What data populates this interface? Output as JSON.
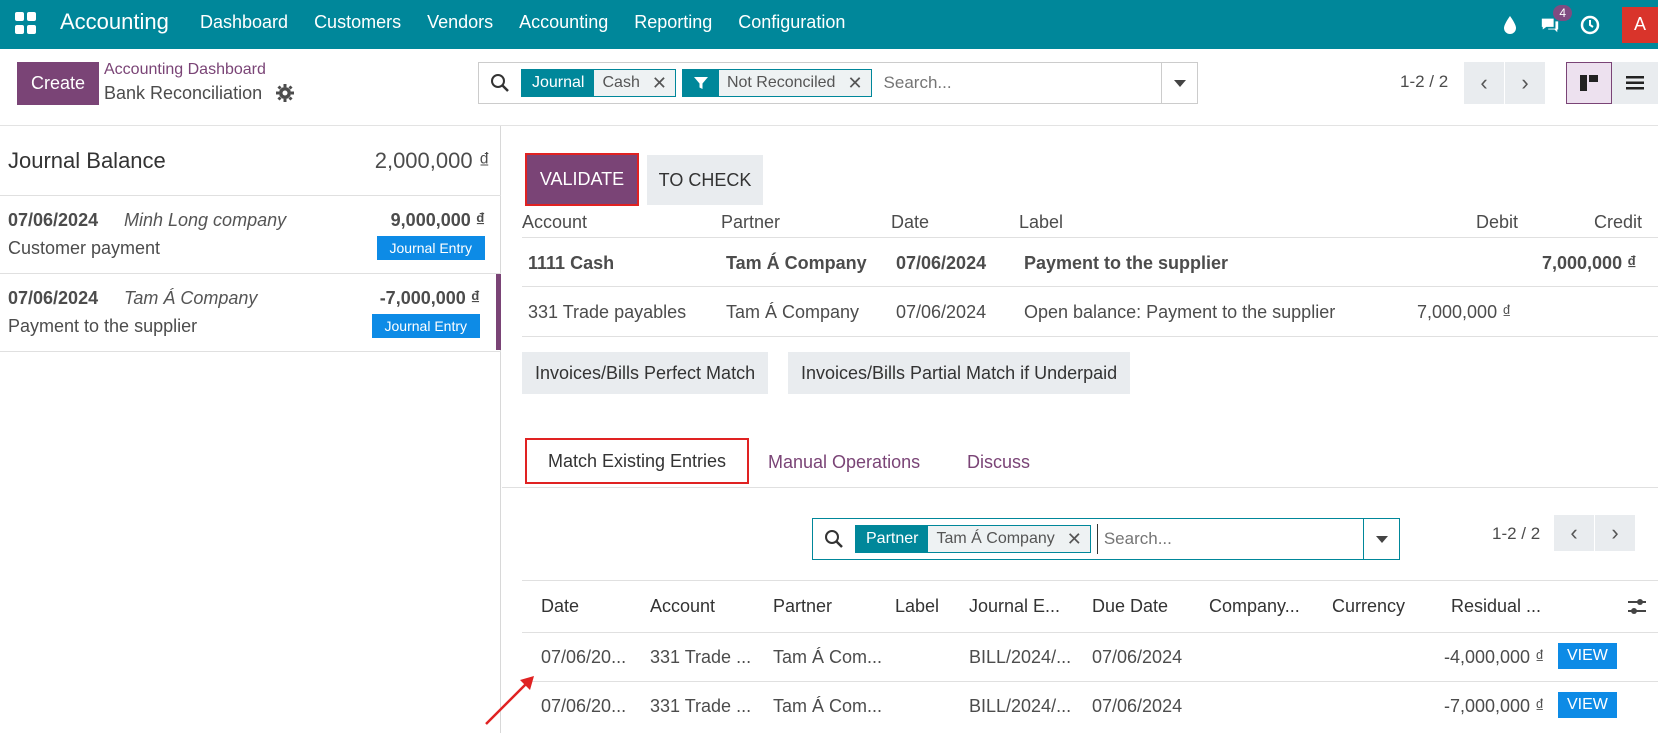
{
  "navbar": {
    "brand": "Accounting",
    "menu": [
      "Dashboard",
      "Customers",
      "Vendors",
      "Accounting",
      "Reporting",
      "Configuration"
    ],
    "chat_count": "4",
    "avatar_letter": "A",
    "bg_color": "#00879a"
  },
  "control": {
    "create_label": "Create",
    "breadcrumb_parent": "Accounting Dashboard",
    "breadcrumb_current": "Bank Reconciliation",
    "facets": [
      {
        "key": "Journal",
        "value": "Cash"
      },
      {
        "key": "filter-icon",
        "value": "Not Reconciled"
      }
    ],
    "search_placeholder": "Search...",
    "pager": "1-2 / 2"
  },
  "left": {
    "balance_title": "Journal Balance",
    "balance_value": "2,000,000 ₫",
    "statements": [
      {
        "date": "07/06/2024",
        "partner": "Minh Long company",
        "amount": "9,000,000 ₫",
        "label": "Customer payment",
        "badge": "Journal Entry"
      },
      {
        "date": "07/06/2024",
        "partner": "Tam Á Company",
        "amount": "-7,000,000 ₫",
        "label": "Payment to the supplier",
        "badge": "Journal Entry"
      }
    ]
  },
  "right": {
    "validate_label": "VALIDATE",
    "tocheck_label": "TO CHECK",
    "columns": {
      "account": "Account",
      "partner": "Partner",
      "date": "Date",
      "label": "Label",
      "debit": "Debit",
      "credit": "Credit"
    },
    "rows": [
      {
        "account": "1111 Cash",
        "partner": "Tam Á Company",
        "date": "07/06/2024",
        "label": "Payment to the supplier",
        "debit": "",
        "credit": "7,000,000 ₫"
      },
      {
        "account": "331 Trade payables",
        "partner": "Tam Á Company",
        "date": "07/06/2024",
        "label": "Open balance: Payment to the supplier",
        "debit": "7,000,000 ₫",
        "credit": ""
      }
    ],
    "models": [
      "Invoices/Bills Perfect Match",
      "Invoices/Bills Partial Match if Underpaid"
    ],
    "tabs": [
      "Match Existing Entries",
      "Manual Operations",
      "Discuss"
    ],
    "match_search": {
      "facet_key": "Partner",
      "facet_value": "Tam Á Company",
      "placeholder": "Search...",
      "pager": "1-2 / 2"
    },
    "match_columns": [
      "Date",
      "Account",
      "Partner",
      "Label",
      "Journal E...",
      "Due Date",
      "Company...",
      "Currency",
      "Residual ..."
    ],
    "match_rows": [
      {
        "date": "07/06/20...",
        "account": "331 Trade ...",
        "partner": "Tam Á Com...",
        "label": "",
        "journal": "BILL/2024/...",
        "due": "07/06/2024",
        "company": "",
        "currency": "",
        "residual": "-4,000,000 ₫",
        "action": "VIEW"
      },
      {
        "date": "07/06/20...",
        "account": "331 Trade ...",
        "partner": "Tam Á Com...",
        "label": "",
        "journal": "BILL/2024/...",
        "due": "07/06/2024",
        "company": "",
        "currency": "",
        "residual": "-7,000,000 ₫",
        "action": "VIEW"
      }
    ]
  }
}
